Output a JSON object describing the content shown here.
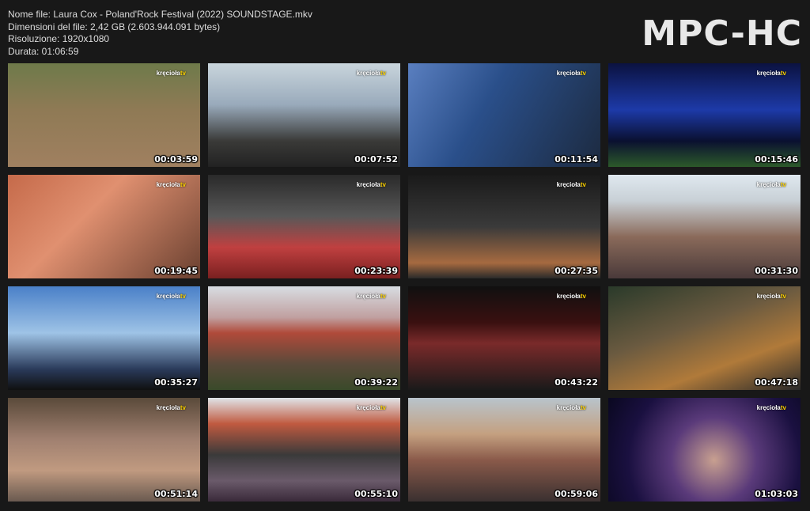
{
  "info": {
    "file_name": "Nome file: Laura Cox - Poland'Rock Festival (2022) SOUNDSTAGE.mkv",
    "file_size": "Dimensioni del file: 2,42 GB (2.603.944.091 bytes)",
    "resolution": "Risoluzione: 1920x1080",
    "duration": "Durata: 01:06:59"
  },
  "logo": "MPC-HC",
  "brand": {
    "name": "kręciołatv",
    "main": "kręcioła",
    "suffix": "tv",
    "color": "#ffd400"
  },
  "thumbnails": [
    {
      "time": "00:03:59"
    },
    {
      "time": "00:07:52"
    },
    {
      "time": "00:11:54"
    },
    {
      "time": "00:15:46"
    },
    {
      "time": "00:19:45"
    },
    {
      "time": "00:23:39"
    },
    {
      "time": "00:27:35"
    },
    {
      "time": "00:31:30"
    },
    {
      "time": "00:35:27"
    },
    {
      "time": "00:39:22"
    },
    {
      "time": "00:43:22"
    },
    {
      "time": "00:47:18"
    },
    {
      "time": "00:51:14"
    },
    {
      "time": "00:55:10"
    },
    {
      "time": "00:59:06"
    },
    {
      "time": "01:03:03"
    }
  ]
}
